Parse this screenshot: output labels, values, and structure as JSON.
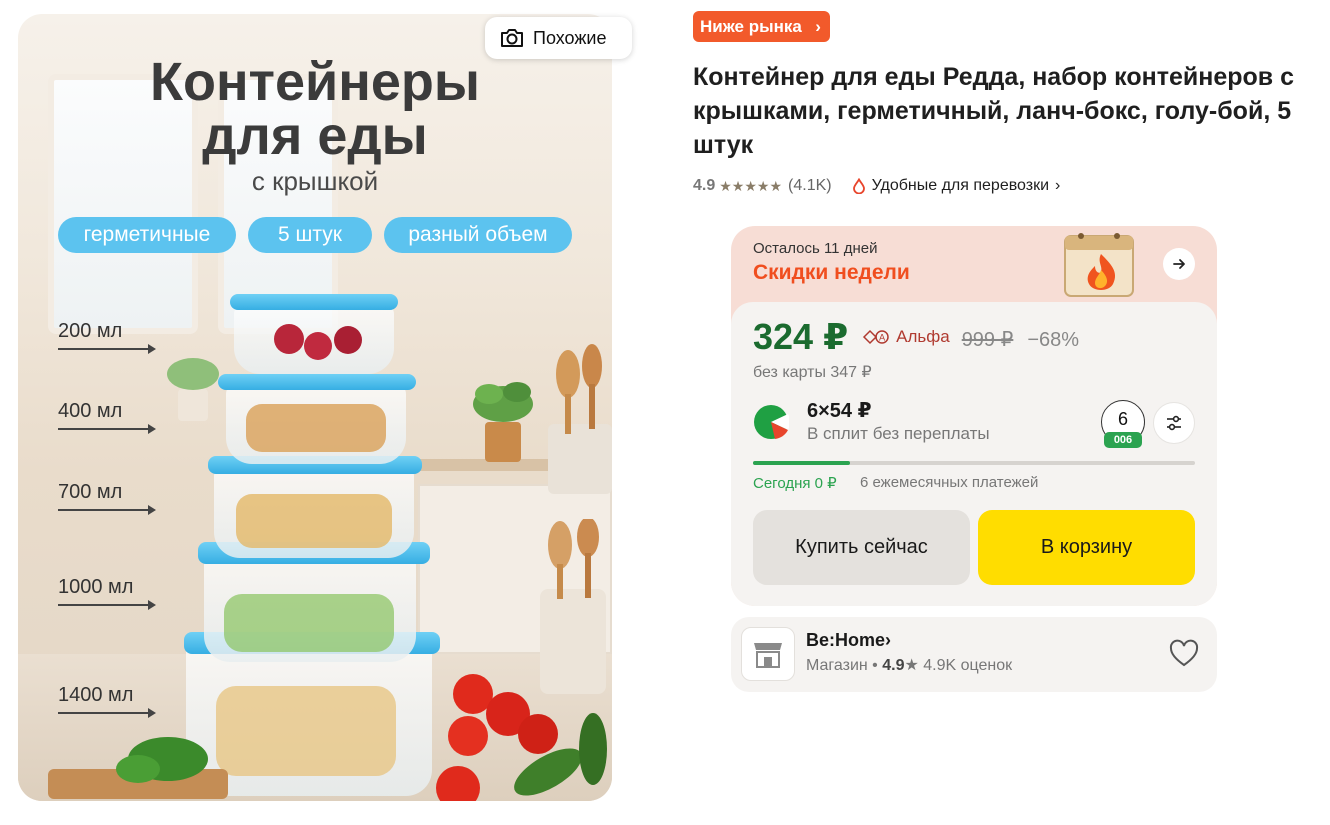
{
  "image": {
    "title_line1": "Контейнеры",
    "title_line2": "для еды",
    "subtitle": "с крышкой",
    "pills": [
      "герметичные",
      "5 штук",
      "разный объем"
    ],
    "volumes": [
      "200 мл",
      "400 мл",
      "700 мл",
      "1000 мл",
      "1400 мл"
    ],
    "similar_label": "Похожие"
  },
  "product": {
    "badge": "Ниже рынка",
    "badge_chevron": "›",
    "title": "Контейнер для еды Редда, набор контейнеров с крышками, герметичный, ланч-бокс, голу-бой, 5 штук",
    "rating": "4.9",
    "stars": "★★★★★",
    "reviews": "(4.1K)",
    "convenient": "Удобные для перевозки",
    "convenient_chevron": "›"
  },
  "deal": {
    "remaining": "Осталось 11 дней",
    "title": "Скидки недели",
    "price": "324 ₽",
    "alfa_label": "Альфа",
    "old_price": "999 ₽",
    "discount": "−68%",
    "no_card": "без карты 347 ₽",
    "split_amount": "6×54 ₽",
    "split_desc": "В сплит без переплаты",
    "split_months": "6",
    "split_months_tag": "006",
    "split_progress": 0.22,
    "today": "Сегодня 0 ₽",
    "monthly": "6 ежемесячных платежей",
    "buy_now": "Купить сейчас",
    "add_to_cart": "В корзину"
  },
  "shop": {
    "name": "Be:Home",
    "chevron": "›",
    "type": "Магазин",
    "separator": "•",
    "rating": "4.9",
    "star": "★",
    "reviews": "4.9K оценок"
  },
  "colors": {
    "badge_market": "#f25a2b",
    "price_green": "#1b6b2f",
    "week_orange": "#f04e1f",
    "cart_yellow": "#ffdd00",
    "split_green": "#2ba350"
  }
}
